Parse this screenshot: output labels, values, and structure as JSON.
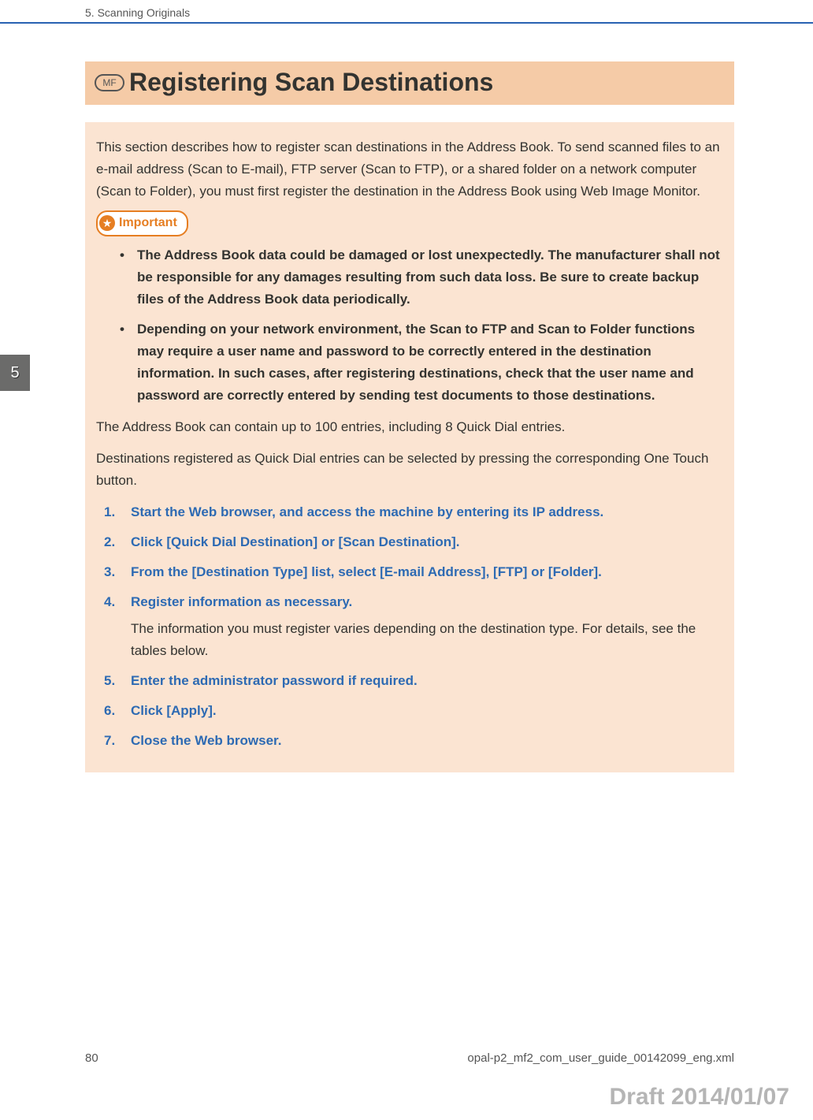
{
  "header": {
    "chapter": "5. Scanning Originals"
  },
  "sideTab": "5",
  "title": {
    "badge": "MF",
    "text": "Registering Scan Destinations"
  },
  "intro": "This section describes how to register scan destinations in the Address Book. To send scanned files to an e-mail address (Scan to E-mail), FTP server (Scan to FTP), or a shared folder on a network computer (Scan to Folder), you must first register the destination in the Address Book using Web Image Monitor.",
  "importantLabel": "Important",
  "importantBullets": [
    "The Address Book data could be damaged or lost unexpectedly. The manufacturer shall not be responsible for any damages resulting from such data loss. Be sure to create backup files of the Address Book data periodically.",
    "Depending on your network environment, the Scan to FTP and Scan to Folder functions may require a user name and password to be correctly entered in the destination information. In such cases, after registering destinations, check that the user name and password are correctly entered by sending test documents to those destinations."
  ],
  "para1": "The Address Book can contain up to 100 entries, including 8 Quick Dial entries.",
  "para2": "Destinations registered as Quick Dial entries can be selected by pressing the corresponding One Touch button.",
  "steps": [
    {
      "title": "Start the Web browser, and access the machine by entering its IP address.",
      "sub": ""
    },
    {
      "title": "Click [Quick Dial Destination] or [Scan Destination].",
      "sub": ""
    },
    {
      "title": "From the [Destination Type] list, select [E-mail Address], [FTP] or [Folder].",
      "sub": ""
    },
    {
      "title": "Register information as necessary.",
      "sub": "The information you must register varies depending on the destination type. For details, see the tables below."
    },
    {
      "title": "Enter the administrator password if required.",
      "sub": ""
    },
    {
      "title": "Click [Apply].",
      "sub": ""
    },
    {
      "title": "Close the Web browser.",
      "sub": ""
    }
  ],
  "footer": {
    "pageNumber": "80",
    "filename": "opal-p2_mf2_com_user_guide_00142099_eng.xml"
  },
  "draft": "Draft 2014/01/07"
}
